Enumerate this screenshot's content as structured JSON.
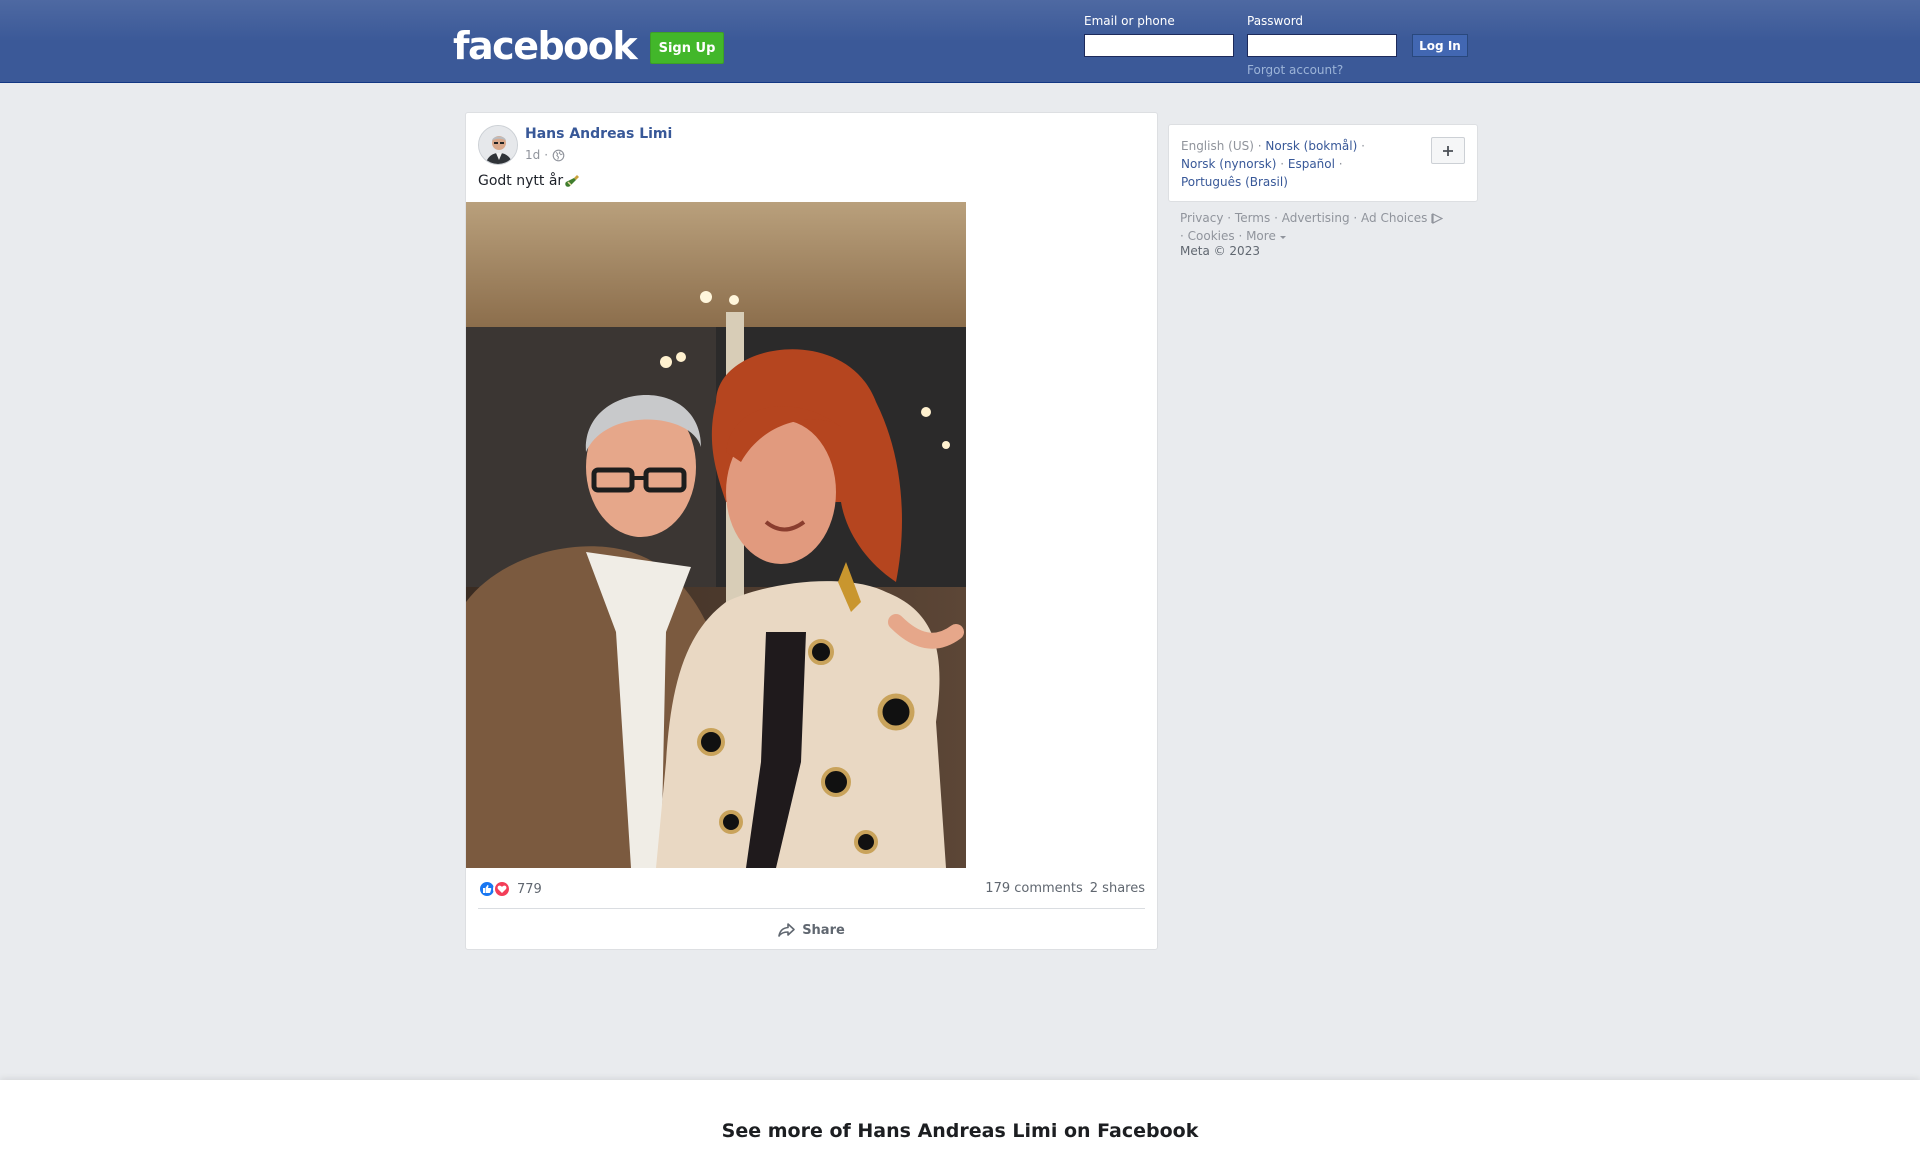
{
  "header": {
    "logo_text": "facebook",
    "signup_label": "Sign Up",
    "email_label": "Email or phone",
    "email_value": "",
    "password_label": "Password",
    "password_value": "",
    "login_label": "Log In",
    "forgot_label": "Forgot account?"
  },
  "post": {
    "author": "Hans Andreas Limi",
    "time": "1d",
    "separator": "·",
    "text": "Godt nytt år",
    "reactions_count": "779",
    "comments": "179 comments",
    "shares": "2 shares",
    "share_label": "Share"
  },
  "sidebar": {
    "languages": {
      "current": "English (US)",
      "others": [
        "Norsk (bokmål)",
        "Norsk (nynorsk)",
        "Español",
        "Português (Brasil)"
      ]
    },
    "footer_links": [
      "Privacy",
      "Terms",
      "Advertising",
      "Ad Choices",
      "Cookies",
      "More"
    ],
    "copyright": "Meta © 2023"
  },
  "banner": {
    "text": "See more of Hans Andreas Limi on Facebook"
  },
  "colors": {
    "brand": "#3b5998",
    "signup": "#42b72a",
    "link": "#385898"
  }
}
